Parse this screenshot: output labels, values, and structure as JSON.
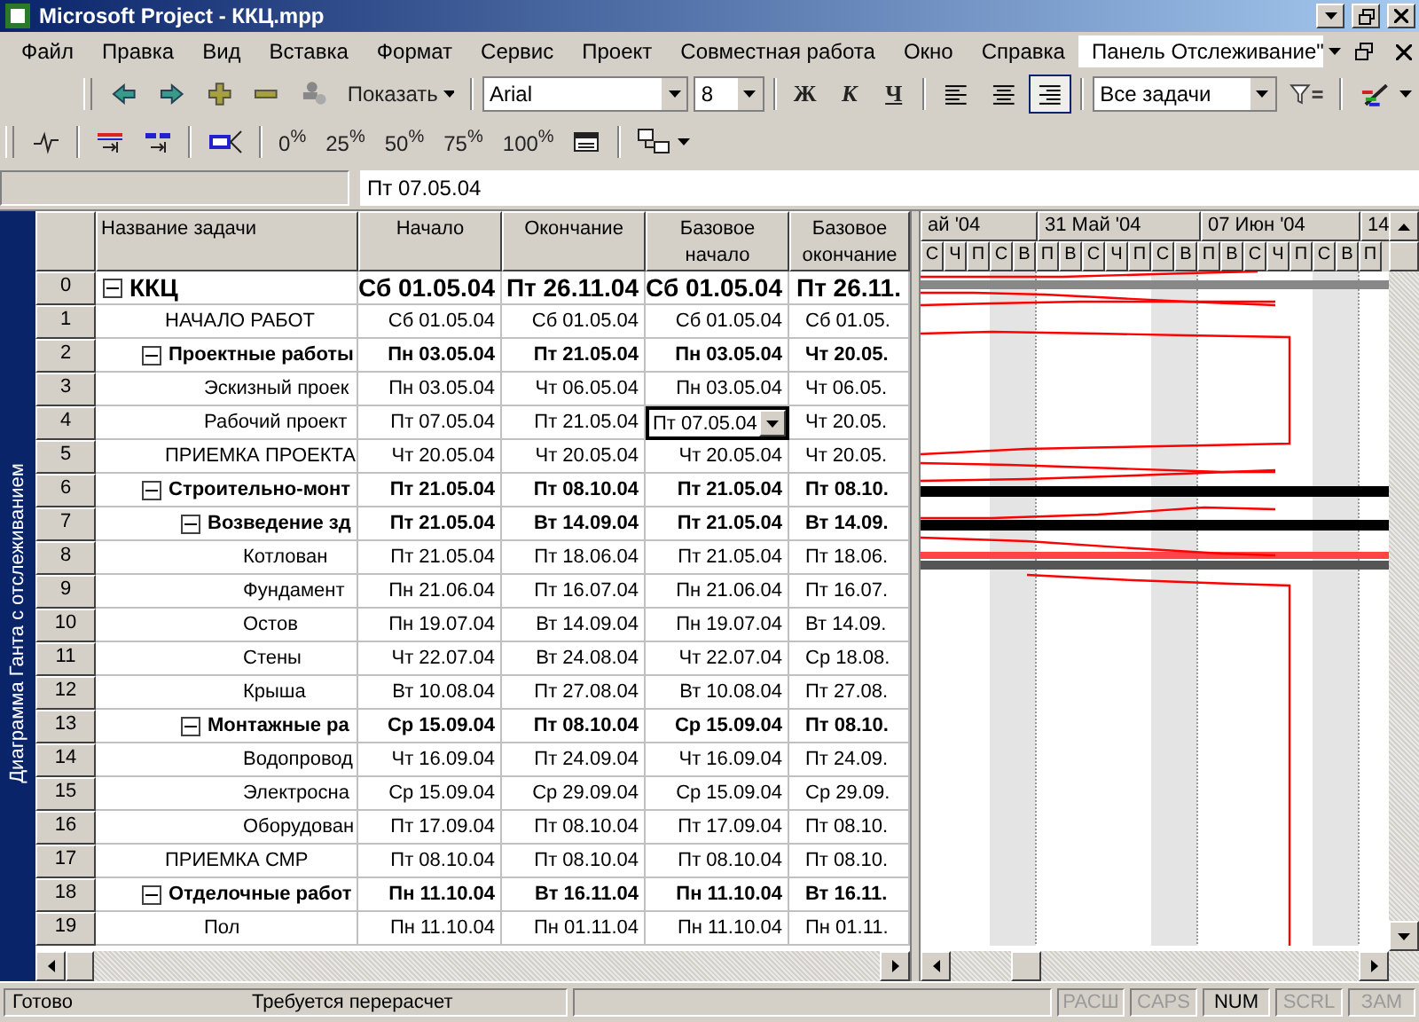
{
  "window": {
    "title": "Microsoft Project - ККЦ.mpp"
  },
  "menu": [
    "Файл",
    "Правка",
    "Вид",
    "Вставка",
    "Формат",
    "Сервис",
    "Проект",
    "Совместная работа",
    "Окно",
    "Справка"
  ],
  "panel_dropdown": {
    "value": "Панель Отслеживание\""
  },
  "toolbar": {
    "show_button": "Показать",
    "font": "Arial",
    "font_size": "8",
    "bold": "Ж",
    "italic": "К",
    "underline": "Ч",
    "align": [
      {
        "kind": "left",
        "selected": false
      },
      {
        "kind": "center",
        "selected": false
      },
      {
        "kind": "right",
        "selected": true
      }
    ],
    "filter": "Все задачи"
  },
  "progress_buttons": [
    "0$^{%}$",
    "25$^{%}$",
    "50$^{%}$",
    "75$^{%}$",
    "100$^{%}$"
  ],
  "entry_bar": {
    "value": "Пт 07.05.04"
  },
  "view_bar": {
    "label": "Диаграмма Ганта с отслеживанием"
  },
  "table": {
    "columns": [
      "Название задачи",
      "Начало",
      "Окончание",
      "Базовое начало",
      "Базовое окончание"
    ],
    "rows": [
      {
        "row": "0",
        "name": "ККЦ",
        "start": "Сб 01.05.04",
        "finish": "Пт 26.11.04",
        "base_start": "Сб 01.05.04",
        "base_finish": "Пт 26.11.",
        "editing": false,
        "expanded": true,
        "children": [
          {
            "row": "1",
            "name": "НАЧАЛО РАБОТ",
            "start": "Сб 01.05.04",
            "finish": "Сб 01.05.04",
            "base_start": "Сб 01.05.04",
            "base_finish": "Сб 01.05.",
            "editing": false
          },
          {
            "row": "2",
            "name": "Проектные работы",
            "start": "Пн 03.05.04",
            "finish": "Пт 21.05.04",
            "base_start": "Пн 03.05.04",
            "base_finish": "Чт 20.05.",
            "editing": false,
            "expanded": true,
            "children": [
              {
                "row": "3",
                "name": "Эскизный проек",
                "start": "Пн 03.05.04",
                "finish": "Чт 06.05.04",
                "base_start": "Пн 03.05.04",
                "base_finish": "Чт 06.05.",
                "editing": false
              },
              {
                "row": "4",
                "name": "Рабочий проект",
                "start": "Пт 07.05.04",
                "finish": "Пт 21.05.04",
                "base_start": "Пт 07.05.04",
                "base_finish": "Чт 20.05.",
                "editing": true
              }
            ]
          },
          {
            "row": "5",
            "name": "ПРИЕМКА ПРОЕКТА",
            "start": "Чт 20.05.04",
            "finish": "Чт 20.05.04",
            "base_start": "Чт 20.05.04",
            "base_finish": "Чт 20.05.",
            "editing": false
          },
          {
            "row": "6",
            "name": "Строительно-монт",
            "start": "Пт 21.05.04",
            "finish": "Пт 08.10.04",
            "base_start": "Пт 21.05.04",
            "base_finish": "Пт 08.10.",
            "editing": false,
            "expanded": true,
            "children": [
              {
                "row": "7",
                "name": "Возведение зд",
                "start": "Пт 21.05.04",
                "finish": "Вт 14.09.04",
                "base_start": "Пт 21.05.04",
                "base_finish": "Вт 14.09.",
                "editing": false,
                "expanded": true,
                "children": [
                  {
                    "row": "8",
                    "name": "Котлован",
                    "start": "Пт 21.05.04",
                    "finish": "Пт 18.06.04",
                    "base_start": "Пт 21.05.04",
                    "base_finish": "Пт 18.06.",
                    "editing": false
                  },
                  {
                    "row": "9",
                    "name": "Фундамент",
                    "start": "Пн 21.06.04",
                    "finish": "Пт 16.07.04",
                    "base_start": "Пн 21.06.04",
                    "base_finish": "Пт 16.07.",
                    "editing": false
                  },
                  {
                    "row": "10",
                    "name": "Остов",
                    "start": "Пн 19.07.04",
                    "finish": "Вт 14.09.04",
                    "base_start": "Пн 19.07.04",
                    "base_finish": "Вт 14.09.",
                    "editing": false
                  },
                  {
                    "row": "11",
                    "name": "Стены",
                    "start": "Чт 22.07.04",
                    "finish": "Вт 24.08.04",
                    "base_start": "Чт 22.07.04",
                    "base_finish": "Ср 18.08.",
                    "editing": false
                  },
                  {
                    "row": "12",
                    "name": "Крыша",
                    "start": "Вт 10.08.04",
                    "finish": "Пт 27.08.04",
                    "base_start": "Вт 10.08.04",
                    "base_finish": "Пт 27.08.",
                    "editing": false
                  }
                ]
              },
              {
                "row": "13",
                "name": "Монтажные ра",
                "start": "Ср 15.09.04",
                "finish": "Пт 08.10.04",
                "base_start": "Ср 15.09.04",
                "base_finish": "Пт 08.10.",
                "editing": false,
                "expanded": true,
                "children": [
                  {
                    "row": "14",
                    "name": "Водопровод",
                    "start": "Чт 16.09.04",
                    "finish": "Пт 24.09.04",
                    "base_start": "Чт 16.09.04",
                    "base_finish": "Пт 24.09.",
                    "editing": false
                  },
                  {
                    "row": "15",
                    "name": "Электросна",
                    "start": "Ср 15.09.04",
                    "finish": "Ср 29.09.04",
                    "base_start": "Ср 15.09.04",
                    "base_finish": "Ср 29.09.",
                    "editing": false
                  },
                  {
                    "row": "16",
                    "name": "Оборудован",
                    "start": "Пт 17.09.04",
                    "finish": "Пт 08.10.04",
                    "base_start": "Пт 17.09.04",
                    "base_finish": "Пт 08.10.",
                    "editing": false
                  }
                ]
              }
            ]
          },
          {
            "row": "17",
            "name": "ПРИЕМКА СМР",
            "start": "Пт 08.10.04",
            "finish": "Пт 08.10.04",
            "base_start": "Пт 08.10.04",
            "base_finish": "Пт 08.10.",
            "editing": false
          },
          {
            "row": "18",
            "name": "Отделочные работ",
            "start": "Пн 11.10.04",
            "finish": "Вт 16.11.04",
            "base_start": "Пн 11.10.04",
            "base_finish": "Вт 16.11.",
            "editing": false,
            "expanded": true,
            "children": [
              {
                "row": "19",
                "name": "Пол",
                "start": "Пн 11.10.04",
                "finish": "Пн 01.11.04",
                "base_start": "Пн 11.10.04",
                "base_finish": "Пн 01.11.",
                "editing": false
              }
            ]
          }
        ]
      }
    ]
  },
  "timescale": {
    "months": [
      "ай '04",
      "31 Май '04",
      "07 Июн '04",
      "14"
    ],
    "days": [
      "С",
      "Ч",
      "П",
      "С",
      "В",
      "П",
      "В",
      "С",
      "Ч",
      "П",
      "С",
      "В",
      "П",
      "В",
      "С",
      "Ч",
      "П",
      "С",
      "В",
      "П"
    ]
  },
  "status_bar": {
    "state": "Готово",
    "message": "Требуется перерасчет",
    "indicators": [
      {
        "label": "РАСШ",
        "on": false
      },
      {
        "label": "CAPS",
        "on": false
      },
      {
        "label": "NUM",
        "on": true
      },
      {
        "label": "SCRL",
        "on": false
      },
      {
        "label": "ЗАМ",
        "on": false
      }
    ]
  }
}
